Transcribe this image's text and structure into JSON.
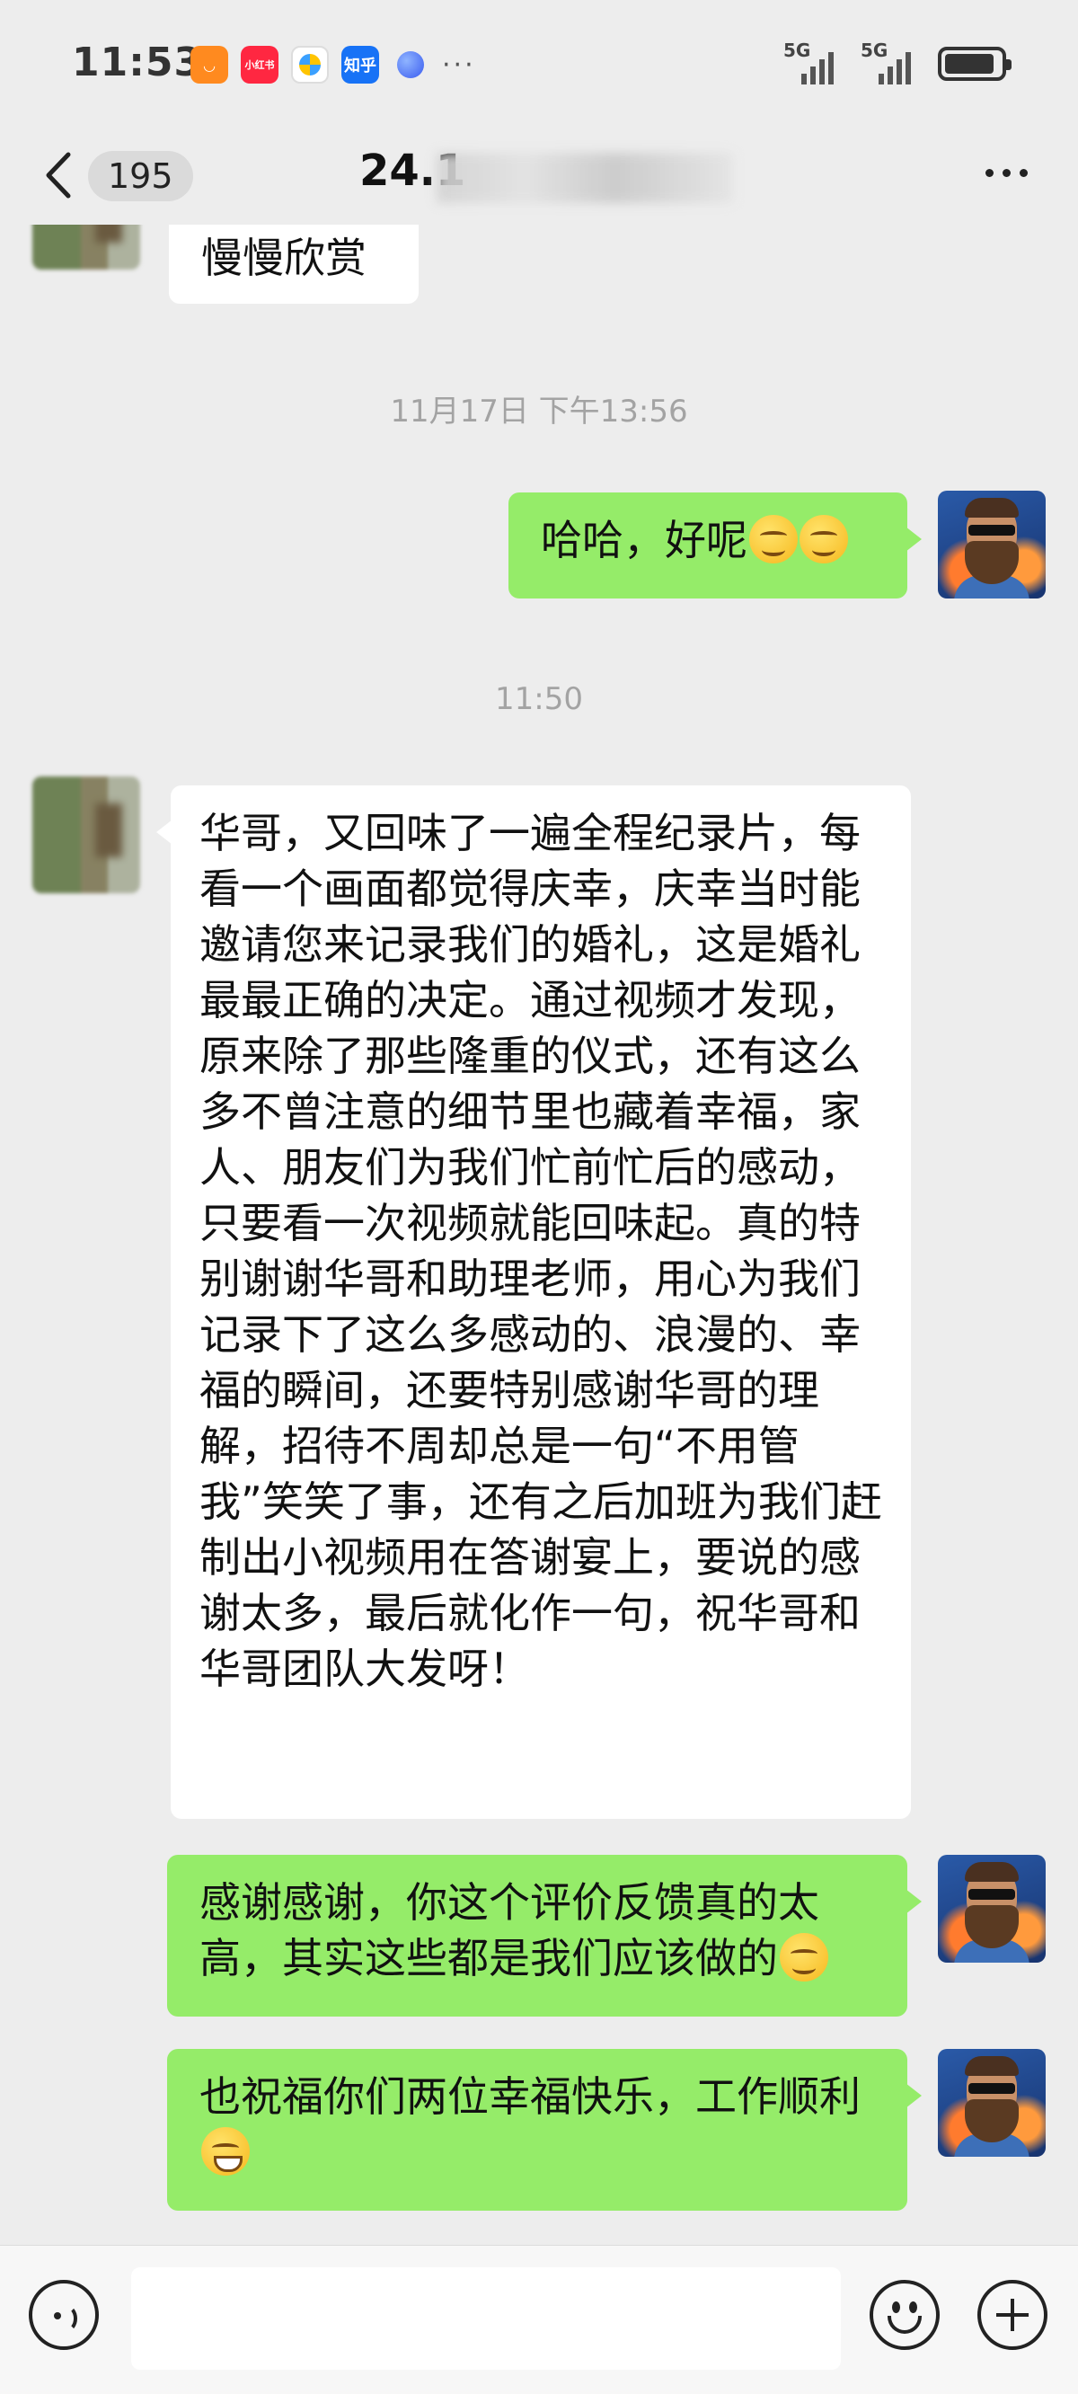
{
  "status_bar": {
    "time": "11:53",
    "app_icons": [
      "taobao-icon",
      "xiaohongshu-icon",
      "pinwheel-icon",
      "zhihu-icon",
      "browser-icon"
    ],
    "xhs_label": "小红书",
    "zhihu_label": "知乎",
    "more": "···",
    "signals": [
      "5G",
      "5G"
    ],
    "battery_level": 0.9
  },
  "header": {
    "back_icon": "chevron-left-icon",
    "unread_count": "195",
    "title": "24.1",
    "more_icon": "more-dots-icon"
  },
  "messages": [
    {
      "side": "left",
      "text": "慢慢欣赏"
    },
    {
      "type": "timestamp",
      "text": "11月17日 下午13:56"
    },
    {
      "side": "right",
      "text": "哈哈，好呢",
      "emoji": [
        "drool-face-emoji",
        "drool-face-emoji"
      ]
    },
    {
      "type": "timestamp",
      "text": "11:50"
    },
    {
      "side": "left",
      "text": "华哥，又回味了一遍全程纪录片，每看一个画面都觉得庆幸，庆幸当时能邀请您来记录我们的婚礼，这是婚礼最最正确的决定。通过视频才发现，原来除了那些隆重的仪式，还有这么多不曾注意的细节里也藏着幸福，家人、朋友们为我们忙前忙后的感动，只要看一次视频就能回味起。真的特别谢谢华哥和助理老师，用心为我们记录下了这么多感动的、浪漫的、幸福的瞬间，还要特别感谢华哥的理解，招待不周却总是一句“不用管我”笑笑了事，还有之后加班为我们赶制出小视频用在答谢宴上，要说的感谢太多，最后就化作一句，祝华哥和华哥团队大发呀！"
    },
    {
      "side": "right",
      "text": "感谢感谢，你这个评价反馈真的太高，其实这些都是我们应该做的",
      "emoji": [
        "smile-emoji"
      ]
    },
    {
      "side": "right",
      "text": "也祝福你们两位幸福快乐，工作顺利",
      "emoji": [
        "grin-emoji"
      ]
    }
  ],
  "input_bar": {
    "voice_icon": "voice-icon",
    "input_value": "",
    "emoji_icon": "emoji-face-icon",
    "plus_icon": "plus-icon"
  }
}
